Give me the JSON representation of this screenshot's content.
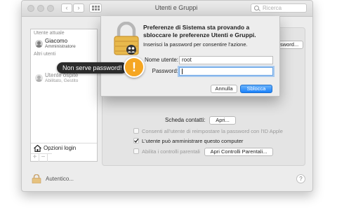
{
  "window": {
    "title": "Utenti e Gruppi"
  },
  "toolbar": {
    "back_glyph": "‹",
    "forward_glyph": "›",
    "search_placeholder": "Ricerca"
  },
  "sidebar": {
    "current_users_header": "Utente attuale",
    "current_user": {
      "name": "Giacomo",
      "role": "Amministratore"
    },
    "other_users_header": "Altri utenti",
    "guest_user": {
      "name": "Utente ospite",
      "role": "Abilitato, Gestito"
    },
    "login_options_label": "Opzioni login",
    "add_glyph": "+",
    "remove_glyph": "−"
  },
  "content": {
    "change_password_button": "bia password...",
    "contact_card_label": "Scheda contatti:",
    "open_button": "Apri...",
    "checkboxes": [
      {
        "label": "Consenti all'utente di reimpostare la password con l'ID Apple",
        "checked": false,
        "enabled": false
      },
      {
        "label": "L'utente può amministrare questo computer",
        "checked": true,
        "enabled": true
      },
      {
        "label": "Abilita i controlli parentali",
        "checked": false,
        "enabled": false
      }
    ],
    "open_parental_controls_button": "Apri Controlli Parentali..."
  },
  "footer": {
    "authenticate_label": "Autentico...",
    "help_glyph": "?"
  },
  "dialog": {
    "title": "Preferenze di Sistema sta provando a sbloccare le preferenze Utenti e Gruppi.",
    "subtitle": "Inserisci la password per consentire l'azione.",
    "username_label": "Nome utente:",
    "username_value": "root",
    "password_label": "Password:",
    "password_value": "",
    "cancel_button": "Annulla",
    "unlock_button": "Sblocca"
  },
  "callout": {
    "text": "Non serve password!",
    "badge_glyph": "!"
  },
  "colors": {
    "accent": "#1a82fb",
    "warning": "#f5a623",
    "callout_bg": "#2b2b2b"
  }
}
